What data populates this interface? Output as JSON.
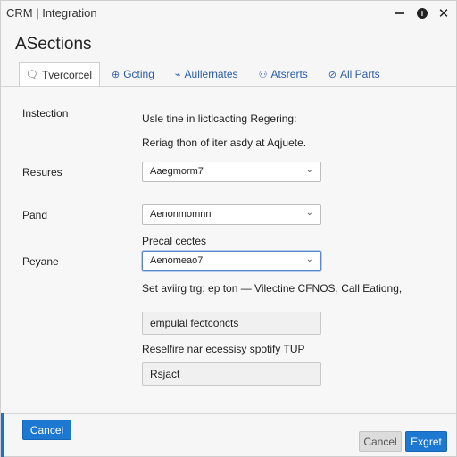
{
  "window": {
    "title": "CRM  |  Integration",
    "info_glyph": "i",
    "close_glyph": "✕"
  },
  "heading": "ASections",
  "tabs": [
    {
      "label": "Tvercorcel",
      "icon": "chat-icon",
      "glyph": "🗨",
      "active": true
    },
    {
      "label": "Gcting",
      "icon": "globe-icon",
      "glyph": "⊕",
      "active": false
    },
    {
      "label": "Aullernates",
      "icon": "link-icon",
      "glyph": "⌁",
      "active": false
    },
    {
      "label": "Atsrerts",
      "icon": "people-icon",
      "glyph": "⚇",
      "active": false
    },
    {
      "label": "All Parts",
      "icon": "tag-icon",
      "glyph": "⊘",
      "active": false
    }
  ],
  "form": {
    "instruction_label": "Instection",
    "instruction_line1": "Usle tine in lictlcacting Regering:",
    "instruction_line2": "Reriag thon of iter asdy at Aqjuete.",
    "resources_label": "Resures",
    "resources_value": "Aaegmorm7",
    "pand_label": "Pand",
    "pand_value": "Aenonmomnn",
    "preval_caption": "Precal cectes",
    "peyane_label": "Peyane",
    "peyane_value": "Aenomeao7",
    "set_text": "Set aviirg trg: ep ton — Vilectine CFNOS, Call Eationg,",
    "field1_value": "empulal fectconcts",
    "reserve_text": "Reselfire nar ecessisy spotify TUP",
    "field2_value": "Rsjact"
  },
  "footer": {
    "cancel_left": "Cancel",
    "cancel_right": "Cancel",
    "submit": "Exgret"
  },
  "colors": {
    "accent": "#1d78d1",
    "tab_link": "#2a5ca8"
  }
}
